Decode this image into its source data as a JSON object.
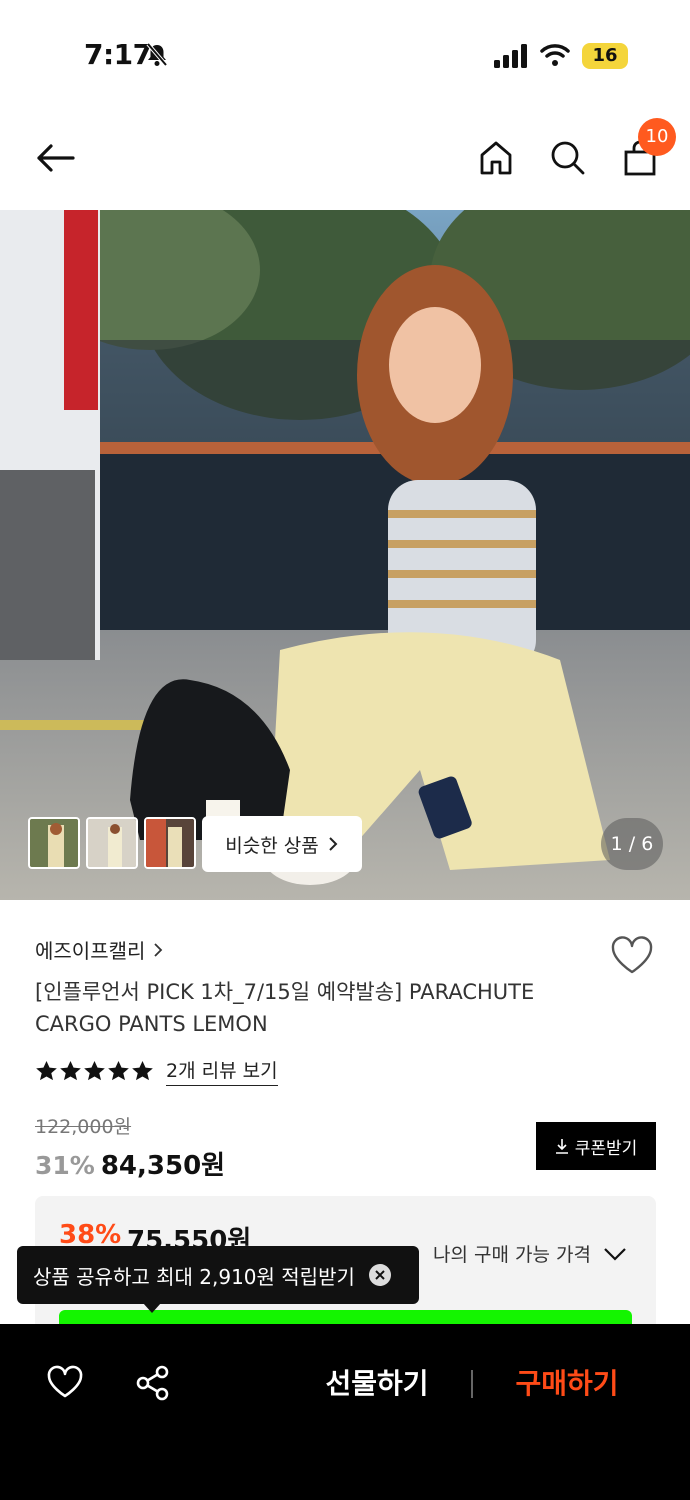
{
  "status_bar": {
    "time": "7:17",
    "battery": "16"
  },
  "nav": {
    "cart_badge": "10"
  },
  "gallery": {
    "similar_label": "비슷한 상품",
    "page_indicator": "1 / 6"
  },
  "product": {
    "brand": "에즈이프캘리",
    "title": "[인플루언서 PICK 1차_7/15일 예약발송] PARACHUTE CARGO PANTS LEMON",
    "rating_stars": 5,
    "review_link": "2개 리뷰 보기",
    "original_price": "122,000원",
    "discount_rate": "31%",
    "sale_price": "84,350원",
    "coupon_label": "쿠폰받기"
  },
  "my_price": {
    "rate": "38%",
    "price": "75,550원",
    "label": "나의 구매 가능 가격"
  },
  "tooltip": {
    "text": "상품 공유하고 최대 2,910원 적립받기"
  },
  "bottom_bar": {
    "gift_label": "선물하기",
    "buy_label": "구매하기"
  },
  "colors": {
    "accent": "#ff4b17",
    "badge": "#ff5a1f",
    "highlight": "#14f500"
  }
}
